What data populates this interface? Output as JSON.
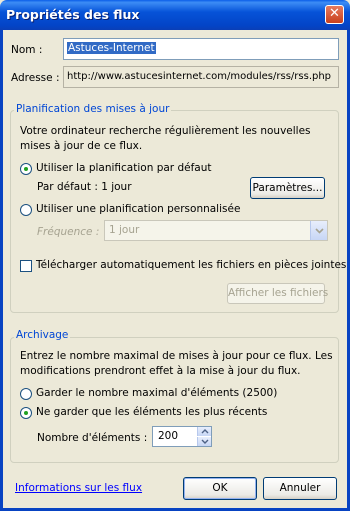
{
  "window": {
    "title": "Propriétés des flux",
    "close_glyph": "✕"
  },
  "name_field": {
    "label": "Nom :",
    "value": "Astuces-Internet"
  },
  "address_field": {
    "label": "Adresse :",
    "value": "http://www.astucesinternet.com/modules/rss/rss.php"
  },
  "schedule_group": {
    "legend": "Planification des mises à jour",
    "description": "Votre ordinateur recherche régulièrement les nouvelles mises à jour de ce flux.",
    "default_radio_label": "Utiliser la planification par défaut",
    "default_text": "Par défaut : 1 jour",
    "settings_button": "Paramètres...",
    "custom_radio_label": "Utiliser une planification personnalisée",
    "frequency_label": "Fréquence :",
    "frequency_value": "1 jour",
    "download_checkbox_label": "Télécharger automatiquement les fichiers en pièces jointes",
    "view_files_button": "Afficher les fichiers"
  },
  "archive_group": {
    "legend": "Archivage",
    "description": "Entrez le nombre maximal de mises à jour pour ce flux. Les modifications prendront effet à la mise à jour du flux.",
    "max_radio_label": "Garder le nombre maximal d'éléments (2500)",
    "recent_radio_label": "Ne garder que les éléments les plus récents",
    "count_label": "Nombre d'éléments :",
    "count_value": "200"
  },
  "footer": {
    "info_link": "Informations sur les flux",
    "ok_button": "OK",
    "cancel_button": "Annuler"
  }
}
